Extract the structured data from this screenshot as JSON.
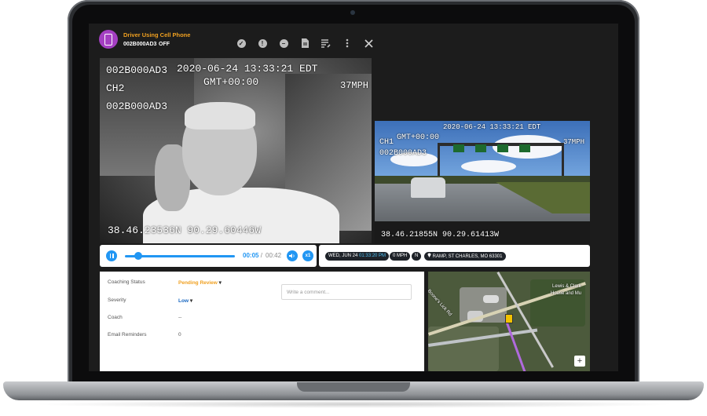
{
  "event": {
    "title": "Driver Using Cell Phone",
    "vehicle_id": "002B000AD3",
    "state": "OFF"
  },
  "toolbar": {
    "icons": [
      "check-circle-icon",
      "exclamation-icon",
      "minus-circle-icon",
      "document-icon",
      "list-edit-icon",
      "more-vertical-icon",
      "close-icon"
    ]
  },
  "camera1": {
    "device": "002B000AD3",
    "channel": "CH2",
    "device_repeat": "002B000AD3",
    "timestamp": "2020-06-24 13:33:21 EDT",
    "timezone": "GMT+00:00",
    "speed": "37MPH",
    "coords": "38.46.23536N 90.29.60446W"
  },
  "camera2": {
    "timestamp": "2020-06-24 13:33:21 EDT",
    "timezone": "GMT+00:00",
    "channel": "CH1",
    "device": "002B000AD3",
    "speed": "37MPH",
    "coords": "38.46.21855N 90.29.61413W"
  },
  "player": {
    "current_time": "00:05",
    "separator": "/",
    "total_time": "00:42",
    "speed_label": "x1",
    "progress": 0.12
  },
  "info": {
    "date": "WED, JUN 24",
    "time": "01:33:20 PM",
    "speed": "0 MPH",
    "heading": "N",
    "location": "RAMP, ST CHARLES, MO 63301"
  },
  "details": {
    "coaching_status_label": "Coaching Status",
    "coaching_status_value": "Pending Review",
    "severity_label": "Severity",
    "severity_value": "Low",
    "coach_label": "Coach",
    "coach_value": "--",
    "email_reminders_label": "Email Reminders",
    "email_reminders_value": "0",
    "comment_placeholder": "Write a comment..."
  },
  "map": {
    "label_1": "Boone's Lick Rd",
    "label_2": "Lewis & Clark",
    "label_3": "House and Mu",
    "zoom_in": "+"
  },
  "colors": {
    "accent": "#2196f3",
    "status_pending": "#f0a020",
    "avatar": "#a43fc2"
  }
}
